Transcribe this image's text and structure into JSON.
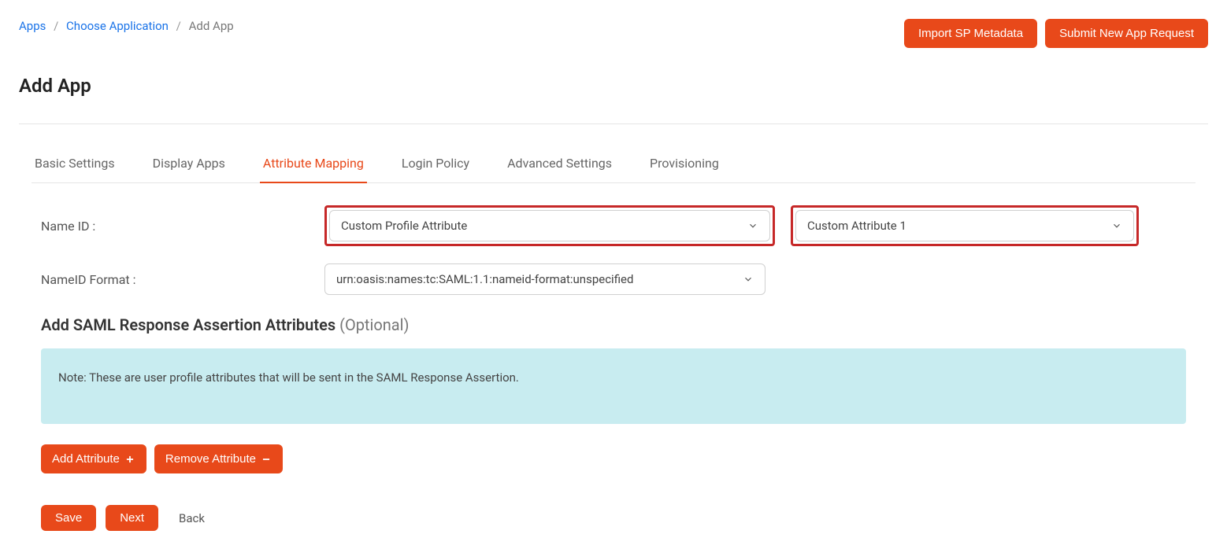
{
  "breadcrumb": {
    "apps": "Apps",
    "choose_app": "Choose Application",
    "current": "Add App"
  },
  "top_buttons": {
    "import_metadata": "Import SP Metadata",
    "submit_request": "Submit New App Request"
  },
  "page_title": "Add App",
  "tabs": {
    "basic": "Basic Settings",
    "display": "Display Apps",
    "attribute": "Attribute Mapping",
    "login": "Login Policy",
    "advanced": "Advanced Settings",
    "provisioning": "Provisioning"
  },
  "form": {
    "name_id_label": "Name ID :",
    "name_id_value": "Custom Profile Attribute",
    "custom_attr_value": "Custom Attribute 1",
    "nameid_format_label": "NameID Format :",
    "nameid_format_value": "urn:oasis:names:tc:SAML:1.1:nameid-format:unspecified"
  },
  "section": {
    "heading": "Add SAML Response Assertion Attributes ",
    "optional": "(Optional)",
    "note": "Note: These are user profile attributes that will be sent in the SAML Response Assertion."
  },
  "attr_buttons": {
    "add": "Add Attribute ",
    "remove": "Remove Attribute "
  },
  "actions": {
    "save": "Save",
    "next": "Next",
    "back": "Back"
  }
}
